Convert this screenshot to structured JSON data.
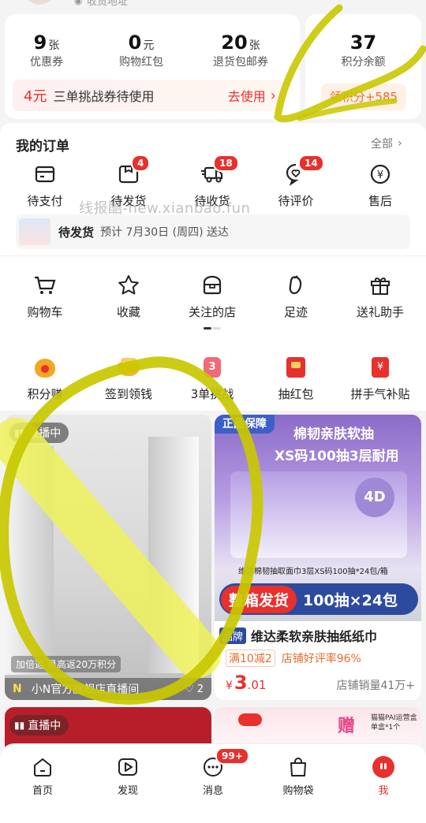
{
  "top_strip": {
    "text": "收货地址"
  },
  "stats": [
    {
      "num": "9",
      "unit": "张",
      "label": "优惠券"
    },
    {
      "num": "0",
      "unit": "元",
      "label": "购物红包"
    },
    {
      "num": "20",
      "unit": "张",
      "label": "退货包邮券"
    }
  ],
  "points": {
    "num": "37",
    "label": "积分余额",
    "button": "领积分+585"
  },
  "coupon_banner": {
    "amount": "4元",
    "text": "三单挑战券待使用",
    "action": "去使用"
  },
  "orders": {
    "title": "我的订单",
    "all_label": "全部",
    "items": [
      {
        "label": "待支付",
        "icon": "wallet-icon",
        "badge": ""
      },
      {
        "label": "待发货",
        "icon": "package-icon",
        "badge": "4"
      },
      {
        "label": "待收货",
        "icon": "truck-icon",
        "badge": "18"
      },
      {
        "label": "待评价",
        "icon": "comment-heart-icon",
        "badge": "14"
      },
      {
        "label": "售后",
        "icon": "refund-icon",
        "badge": ""
      }
    ],
    "watermark": "线报酷-new.xianbao.fun",
    "shipping": {
      "status": "待发货",
      "text": "预计 7月30日 (周四) 送达"
    }
  },
  "tools": [
    {
      "label": "购物车",
      "icon": "cart-icon"
    },
    {
      "label": "收藏",
      "icon": "star-icon"
    },
    {
      "label": "关注的店",
      "icon": "store-icon"
    },
    {
      "label": "足迹",
      "icon": "footprint-icon"
    },
    {
      "label": "送礼助手",
      "icon": "gift-icon"
    }
  ],
  "activities": [
    {
      "label": "积分赚",
      "icon": "money-bag-icon",
      "color": "#f5a623"
    },
    {
      "label": "签到领钱",
      "icon": "gold-pot-icon",
      "color": "#f0b429"
    },
    {
      "label": "3单挑战",
      "icon": "challenge-icon",
      "color": "#f06a7a",
      "badge": "3"
    },
    {
      "label": "抽红包",
      "icon": "red-envelope-icon",
      "color": "#e8302d"
    },
    {
      "label": "拼手气补贴",
      "icon": "subsidy-icon",
      "color": "#e8302d"
    }
  ],
  "feed": {
    "live_card": {
      "live_tag": "直播中",
      "cashback": "加倍返 最高返20万积分",
      "shop": "小N官方旗舰店直播间",
      "likes": "2"
    },
    "product_card": {
      "banner_top": "正品保障",
      "banner_title": "棉韧亲肤软抽",
      "banner_sub": "XS码100抽3层耐用",
      "caption": "维达棉韧抽取面巾3层XS码100抽*24包/箱",
      "ship_label": "整箱发货",
      "qty": "100抽×24包",
      "brand_tag": "品牌",
      "name": "维达柔软亲肤抽纸纸巾",
      "promo": "满10减2",
      "rating": "店铺好评率96%",
      "price_symbol": "¥",
      "price_int": "3",
      "price_dec": ".01",
      "sales": "店铺销量41万+"
    },
    "live_card_2": {
      "live_tag": "直播中"
    },
    "product_card_2": {
      "stamp": "赠",
      "note": "猫猫PAI运营盒 单盒*1个"
    }
  },
  "tabbar": [
    {
      "label": "首页",
      "icon": "home-icon",
      "active": false
    },
    {
      "label": "发现",
      "icon": "play-icon",
      "active": false
    },
    {
      "label": "消息",
      "icon": "chat-icon",
      "badge": "99+",
      "active": false
    },
    {
      "label": "购物袋",
      "icon": "bag-icon",
      "active": false
    },
    {
      "label": "我",
      "icon": "profile-icon",
      "active": true
    }
  ],
  "colors": {
    "accent": "#e8302d",
    "highlighter": "#c9c800",
    "highlighter_fill": "#eef25a"
  }
}
